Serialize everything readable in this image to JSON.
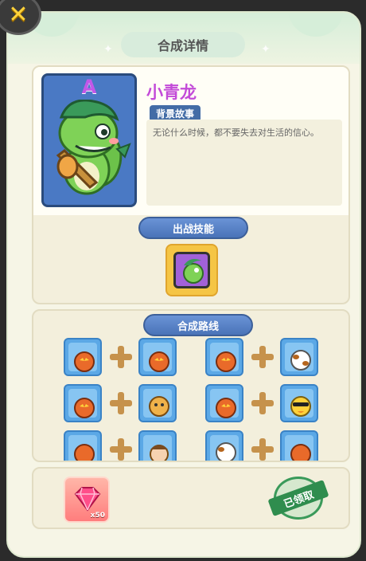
{
  "header": {
    "title": "合成详情",
    "close_symbol": "✕"
  },
  "hero": {
    "rank": "A",
    "name": "小青龙",
    "story_label": "背景故事",
    "story_text": "无论什么时候，都不要失去对生活的信心。"
  },
  "skill": {
    "label": "出战技能",
    "icon": "dragon-skill-icon"
  },
  "route": {
    "label": "合成路线",
    "rows": [
      {
        "left": [
          "pumpkin-monster-icon",
          "pumpkin-monster-icon"
        ],
        "right": [
          "pumpkin-monster-icon",
          "cow-monster-icon"
        ]
      },
      {
        "left": [
          "pumpkin-monster-icon",
          "dog-monster-icon"
        ],
        "right": [
          "pumpkin-monster-icon",
          "duck-sunglasses-monster-icon"
        ]
      },
      {
        "left": [
          "pumpkin-monster-icon",
          "boy-monster-icon"
        ],
        "right": [
          "cow-monster-icon",
          "pumpkin-monster-icon"
        ]
      }
    ]
  },
  "reward": {
    "item": "gem-icon",
    "count": "x50",
    "status": "已领取"
  },
  "colors": {
    "accent_blue": "#4a73b8",
    "name_purple": "#c34bd8",
    "stamp_green": "#2f8d4e",
    "close_yellow": "#ffd23a"
  }
}
